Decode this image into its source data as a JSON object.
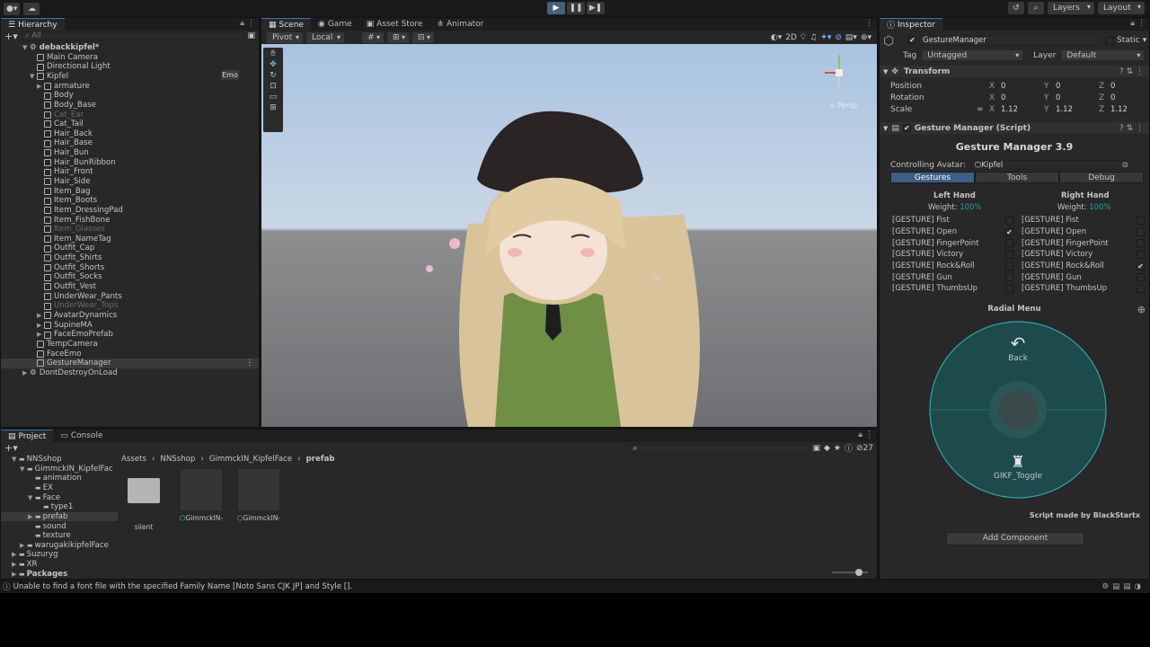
{
  "toolbar": {
    "layers": "Layers",
    "layout": "Layout"
  },
  "hierarchy": {
    "tab": "Hierarchy",
    "search_placeholder": "All",
    "badge": "Emo",
    "items": [
      {
        "label": "debackkipfel*",
        "indent": 0,
        "bold": true,
        "arrow": "▼",
        "icon": "scene"
      },
      {
        "label": "Main Camera",
        "indent": 1
      },
      {
        "label": "Directional Light",
        "indent": 1
      },
      {
        "label": "Kipfel",
        "indent": 1,
        "arrow": "▼"
      },
      {
        "label": "armature",
        "indent": 2,
        "arrow": "▶"
      },
      {
        "label": "Body",
        "indent": 2
      },
      {
        "label": "Body_Base",
        "indent": 2
      },
      {
        "label": "Cat_Ear",
        "indent": 2,
        "dim": true
      },
      {
        "label": "Cat_Tail",
        "indent": 2
      },
      {
        "label": "Hair_Back",
        "indent": 2
      },
      {
        "label": "Hair_Base",
        "indent": 2
      },
      {
        "label": "Hair_Bun",
        "indent": 2
      },
      {
        "label": "Hair_BunRibbon",
        "indent": 2
      },
      {
        "label": "Hair_Front",
        "indent": 2
      },
      {
        "label": "Hair_Side",
        "indent": 2
      },
      {
        "label": "Item_Bag",
        "indent": 2
      },
      {
        "label": "Item_Boots",
        "indent": 2
      },
      {
        "label": "Item_DressingPad",
        "indent": 2
      },
      {
        "label": "Item_FishBone",
        "indent": 2
      },
      {
        "label": "Item_Glasses",
        "indent": 2,
        "dim": true
      },
      {
        "label": "Item_NameTag",
        "indent": 2
      },
      {
        "label": "Outfit_Cap",
        "indent": 2
      },
      {
        "label": "Outfit_Shirts",
        "indent": 2
      },
      {
        "label": "Outfit_Shorts",
        "indent": 2
      },
      {
        "label": "Outfit_Socks",
        "indent": 2
      },
      {
        "label": "Outfit_Vest",
        "indent": 2
      },
      {
        "label": "UnderWear_Pants",
        "indent": 2
      },
      {
        "label": "UnderWear_Tops",
        "indent": 2,
        "dim": true
      },
      {
        "label": "AvatarDynamics",
        "indent": 2,
        "arrow": "▶"
      },
      {
        "label": "SupineMA",
        "indent": 2,
        "arrow": "▶"
      },
      {
        "label": "FaceEmoPrefab",
        "indent": 2,
        "arrow": "▶"
      },
      {
        "label": "TempCamera",
        "indent": 1
      },
      {
        "label": "FaceEmo",
        "indent": 1
      },
      {
        "label": "GestureManager",
        "indent": 1,
        "selected": true
      },
      {
        "label": "DontDestroyOnLoad",
        "indent": 0,
        "arrow": "▶",
        "icon": "scene"
      }
    ]
  },
  "scene": {
    "tabs": [
      "Scene",
      "Game",
      "Asset Store",
      "Animator"
    ],
    "pivot": "Pivot",
    "local": "Local",
    "mode2d": "2D",
    "persp": "< Persp"
  },
  "project": {
    "tabs": [
      "Project",
      "Console"
    ],
    "breadcrumb": [
      "Assets",
      "NNSshop",
      "GimmckIN_KipfelFace",
      "prefab"
    ],
    "hidden_count": "27",
    "tree": [
      {
        "label": "NNSshop",
        "indent": 0,
        "arrow": "▼"
      },
      {
        "label": "GimmckIN_KipfelFac",
        "indent": 1,
        "arrow": "▼"
      },
      {
        "label": "animation",
        "indent": 2
      },
      {
        "label": "EX",
        "indent": 2
      },
      {
        "label": "Face",
        "indent": 2,
        "arrow": "▼"
      },
      {
        "label": "type1",
        "indent": 3
      },
      {
        "label": "prefab",
        "indent": 2,
        "arrow": "▶",
        "selected": true
      },
      {
        "label": "sound",
        "indent": 2
      },
      {
        "label": "texture",
        "indent": 2
      },
      {
        "label": "warugakikipfelFace",
        "indent": 1,
        "arrow": "▶"
      },
      {
        "label": "Suzuryg",
        "indent": 0,
        "arrow": "▶"
      },
      {
        "label": "XR",
        "indent": 0,
        "arrow": "▶"
      },
      {
        "label": "Packages",
        "indent": 0,
        "arrow": "▶",
        "bold": true
      }
    ],
    "assets": [
      "silent",
      "GimmckIN-",
      "GimmckIN-"
    ]
  },
  "inspector": {
    "tab": "Inspector",
    "object_name": "GestureManager",
    "static_label": "Static",
    "tag_label": "Tag",
    "tag_value": "Untagged",
    "layer_label": "Layer",
    "layer_value": "Default",
    "transform": {
      "title": "Transform",
      "rows": [
        {
          "label": "Position",
          "x": "0",
          "y": "0",
          "z": "0"
        },
        {
          "label": "Rotation",
          "x": "0",
          "y": "0",
          "z": "0"
        },
        {
          "label": "Scale",
          "x": "1.12",
          "y": "1.12",
          "z": "1.12"
        }
      ]
    },
    "script": {
      "title": "Gesture Manager (Script)",
      "heading": "Gesture Manager 3.9",
      "controlling_label": "Controlling Avatar:",
      "controlling_value": "Kipfel",
      "tabs": [
        "Gestures",
        "Tools",
        "Debug"
      ],
      "left_title": "Left Hand",
      "right_title": "Right Hand",
      "weight_label": "Weight:",
      "weight_value": "100%",
      "gestures": [
        "[GESTURE] Fist",
        "[GESTURE] Open",
        "[GESTURE] FingerPoint",
        "[GESTURE] Victory",
        "[GESTURE] Rock&Roll",
        "[GESTURE] Gun",
        "[GESTURE] ThumbsUp"
      ],
      "left_checked": [
        false,
        true,
        false,
        false,
        false,
        false,
        false
      ],
      "right_checked": [
        false,
        false,
        false,
        false,
        true,
        false,
        false
      ],
      "radial_title": "Radial Menu",
      "back_label": "Back",
      "toggle_label": "GIKF_Toggle",
      "credit": "Script made by BlackStartx",
      "add_component": "Add Component"
    }
  },
  "status": {
    "message": "Unable to find a font file with the specified Family Name [Noto Sans CJK JP] and Style []."
  }
}
